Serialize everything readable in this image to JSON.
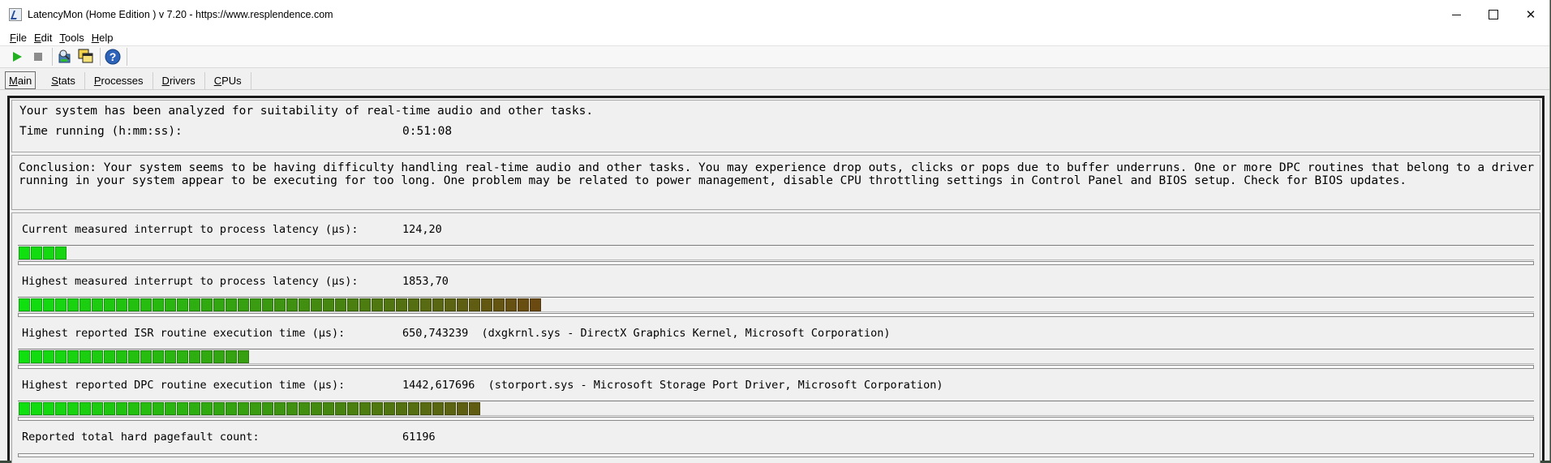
{
  "window": {
    "title": "LatencyMon  (Home Edition )  v 7.20 - https://www.resplendence.com",
    "controls": {
      "minimize": "—",
      "maximize": "☐",
      "close": "✕"
    }
  },
  "menu": [
    "File",
    "Edit",
    "Tools",
    "Help"
  ],
  "toolbar": {
    "icons": [
      "play-icon",
      "stop-icon",
      "analyze-icon",
      "windows-icon",
      "help-icon"
    ]
  },
  "tabs": [
    "Main",
    "Stats",
    "Processes",
    "Drivers",
    "CPUs"
  ],
  "main": {
    "status_text": "Your system has been analyzed for suitability of real-time audio and other tasks.",
    "time_label": "Time running (h:mm:ss):",
    "time_value": "0:51:08",
    "conclusion": "Conclusion: Your system seems to be having difficulty handling real-time audio and other tasks. You may experience drop outs, clicks or pops due to buffer underruns. One or more DPC routines that belong to a driver running in your system appear to be executing for too long. One problem may be related to power management, disable CPU throttling settings in Control Panel and BIOS setup. Check for BIOS updates.",
    "metrics": [
      {
        "label": "Current measured interrupt to process latency (µs):",
        "value": "124,20",
        "segments": 4
      },
      {
        "label": "Highest measured interrupt to process latency (µs):",
        "value": "1853,70",
        "segments": 43
      },
      {
        "label": "Highest reported ISR routine execution time (µs):",
        "value": "650,743239  (dxgkrnl.sys - DirectX Graphics Kernel, Microsoft Corporation)",
        "segments": 19
      },
      {
        "label": "Highest reported DPC routine execution time (µs):",
        "value": "1442,617696  (storport.sys - Microsoft Storage Port Driver, Microsoft Corporation)",
        "segments": 38
      },
      {
        "label": "Reported total hard pagefault count:",
        "value": "61196"
      }
    ]
  },
  "colors": {
    "bar_start": "#10e010",
    "bar_end": "#6b4a12"
  }
}
